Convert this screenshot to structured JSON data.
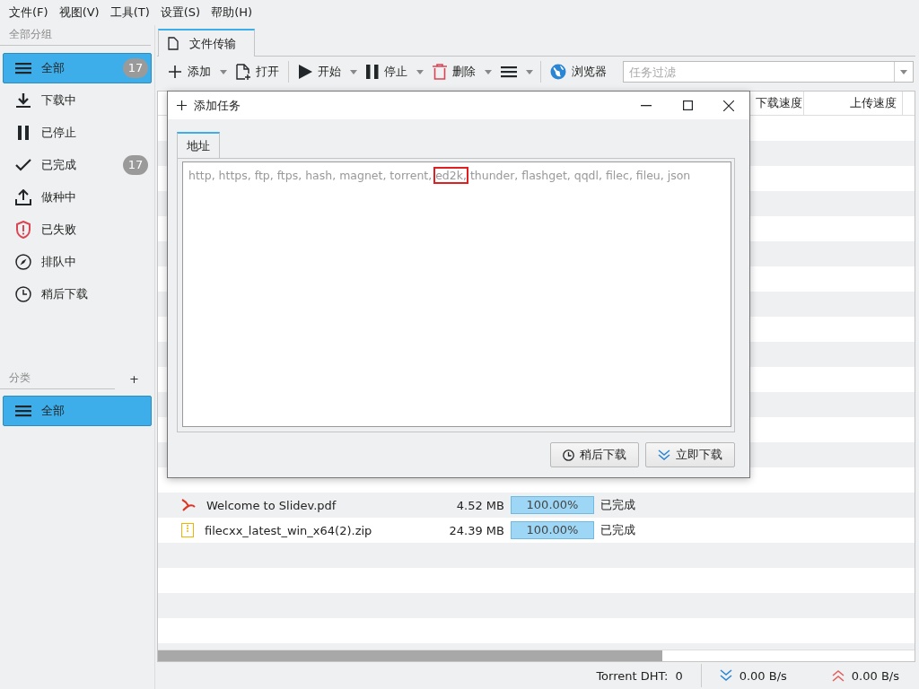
{
  "menu": [
    {
      "label": "文件(F)"
    },
    {
      "label": "视图(V)"
    },
    {
      "label": "工具(T)"
    },
    {
      "label": "设置(S)"
    },
    {
      "label": "帮助(H)"
    }
  ],
  "sidebar": {
    "groups_title": "全部分组",
    "items": [
      {
        "kind": "all",
        "label": "全部",
        "badge": "17",
        "selected": true
      },
      {
        "kind": "downloading",
        "label": "下载中",
        "selected": false
      },
      {
        "kind": "stopped",
        "label": "已停止",
        "selected": false
      },
      {
        "kind": "done",
        "label": "已完成",
        "badge": "17",
        "selected": false
      },
      {
        "kind": "seeding",
        "label": "做种中",
        "selected": false
      },
      {
        "kind": "failed",
        "label": "已失败",
        "selected": false
      },
      {
        "kind": "queued",
        "label": "排队中",
        "selected": false
      },
      {
        "kind": "later",
        "label": "稍后下载",
        "selected": false
      }
    ],
    "category_title": "分类",
    "add_label": "+",
    "categories": [
      {
        "label": "全部",
        "selected": true
      }
    ]
  },
  "tabs": [
    {
      "label": "文件传输",
      "selected": true
    }
  ],
  "toolbar": {
    "buttons": [
      {
        "kind": "add",
        "label": "添加",
        "dropdown": true
      },
      {
        "kind": "open",
        "label": "打开",
        "dropdown": false
      },
      {
        "kind": "separator"
      },
      {
        "kind": "start",
        "label": "开始",
        "dropdown": true
      },
      {
        "kind": "stop",
        "label": "停止",
        "dropdown": true
      },
      {
        "kind": "delete",
        "label": "删除",
        "dropdown": true
      },
      {
        "kind": "menu",
        "dropdown": true
      },
      {
        "kind": "separator"
      },
      {
        "kind": "browser",
        "label": "浏览器",
        "dropdown": false
      }
    ],
    "filter": {
      "placeholder": "任务过滤"
    }
  },
  "table": {
    "columns": [
      {
        "label": "下载速度"
      },
      {
        "label": "上传速度"
      }
    ],
    "rows": [
      {
        "kind": "pdf",
        "name": "Welcome to Slidev.pdf",
        "size": "4.52 MB",
        "level": 1,
        "progress": "100.00%",
        "status": "已完成"
      },
      {
        "kind": "zip",
        "name": "filecxx_latest_win_x64(2).zip",
        "size": "24.39 MB",
        "level": 1,
        "progress": "100.00%",
        "status": "已完成"
      }
    ]
  },
  "dialog": {
    "title": "添加任务",
    "tabs": [
      {
        "label": "地址",
        "selected": true
      }
    ],
    "placeholder_parts": [
      {
        "text": "http, https, ftp, ftps, hash, magnet, torrent, ",
        "highlighted": false
      },
      {
        "text": "ed2k,",
        "highlighted": true
      },
      {
        "text": " thunder, flashget, qqdl, filec, fileu, json",
        "highlighted": false
      }
    ],
    "buttons": [
      {
        "kind": "later",
        "label": "稍后下载"
      },
      {
        "kind": "now",
        "label": "立即下载"
      }
    ]
  },
  "status_bar": {
    "dht_label": "Torrent DHT:",
    "dht_value": "0",
    "download_speed": "0.00 B/s",
    "upload_speed": "0.00 B/s"
  }
}
